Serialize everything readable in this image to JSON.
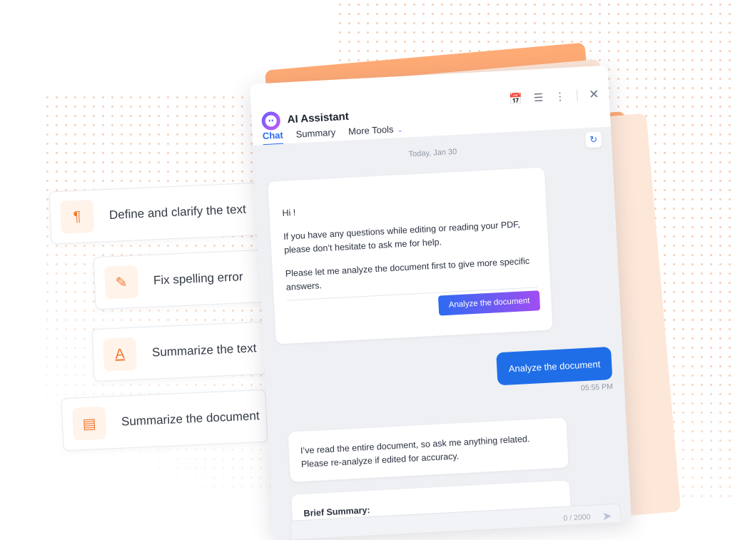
{
  "features": [
    {
      "label": "Define and clarify the text",
      "icon": "paragraph-icon",
      "glyph": "¶"
    },
    {
      "label": "Fix spelling error",
      "icon": "pencil-icon",
      "glyph": "✎"
    },
    {
      "label": "Summarize the text",
      "icon": "letter-a-icon",
      "glyph": "A"
    },
    {
      "label": "Summarize the document",
      "icon": "document-icon",
      "glyph": "▤"
    }
  ],
  "panel": {
    "title": "AI Assistant",
    "tabs": [
      "Chat",
      "Summary",
      "More Tools"
    ],
    "active_tab": "Chat",
    "header_icons": [
      "calendar-history-icon",
      "settings-sliders-icon",
      "more-vertical-icon",
      "close-icon"
    ]
  },
  "chat": {
    "date": "Today, Jan 30",
    "greeting": "Hi !",
    "intro": "If you have any questions while editing or reading your PDF, please don’t hesitate to ask me for help.",
    "analyze_prompt": "Please let me analyze the document first to give more specific answers.",
    "analyze_button": "Analyze the document",
    "user_message": "Analyze the document",
    "user_time": "05:55 PM",
    "bot_reply": "I’ve read the entire document, so ask me anything related. Please re-analyze if edited for accuracy.",
    "summary_heading": "Brief Summary:",
    "input_counter": "0 / 2000"
  },
  "colors": {
    "accent_blue": "#2d6bf2",
    "user_bubble": "#1f6ee8",
    "orange": "#ffab76",
    "icon_orange": "#f07a35"
  }
}
